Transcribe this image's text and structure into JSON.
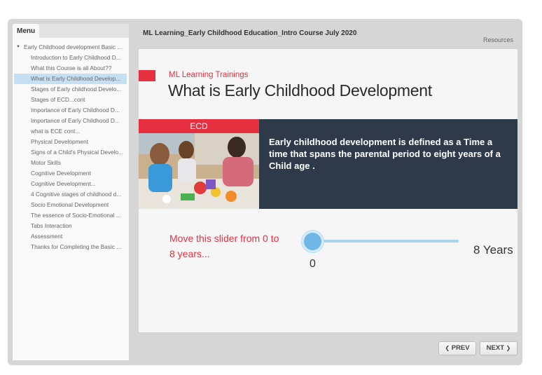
{
  "menu": {
    "tab_label": "Menu",
    "items": [
      {
        "label": "Early Childhood development Basic ...",
        "root": true
      },
      {
        "label": "Introduction to Early Childhood D..."
      },
      {
        "label": "What this Course is all About??"
      },
      {
        "label": "What is Early Childhood Develop...",
        "active": true
      },
      {
        "label": "Stages of Early childhood Develo..."
      },
      {
        "label": "Stages of ECD...cont"
      },
      {
        "label": "Importance of Early Childhood D..."
      },
      {
        "label": "Importance of Early Childhood D..."
      },
      {
        "label": "what is ECE cont..."
      },
      {
        "label": "Physical Development"
      },
      {
        "label": "Signs of a Child's Physical Develo..."
      },
      {
        "label": "Motor Skills"
      },
      {
        "label": "Cognitive Development"
      },
      {
        "label": "Cognitive Development..."
      },
      {
        "label": "4 Cognitive stages of childhood d..."
      },
      {
        "label": "Socio Emotional Development"
      },
      {
        "label": "The essence of Socio-Emotional ..."
      },
      {
        "label": "Tabs Interaction"
      },
      {
        "label": "Assessment"
      },
      {
        "label": "Thanks for Completing the Basic ..."
      }
    ]
  },
  "header": {
    "course_title": "ML Learning_Early Childhood Education_Intro Course July 2020",
    "resources_label": "Resources"
  },
  "slide": {
    "subtitle": "ML Learning Trainings",
    "title": "What is Early Childhood Development",
    "band_label": "ECD",
    "band_text": "Early childhood development is defined as a Time a time that spans the parental period to eight years of a Child age .",
    "slider_prompt": "Move this slider from 0 to 8 years...",
    "slider_value": "0",
    "slider_max_label": "8 Years",
    "slider_level": 0
  },
  "nav": {
    "prev_label": "PREV",
    "next_label": "NEXT"
  },
  "colors": {
    "accent": "#e6303f",
    "band": "#2e3a4a",
    "slider": "#6fb8e6",
    "active_item": "#c6e0f3"
  }
}
